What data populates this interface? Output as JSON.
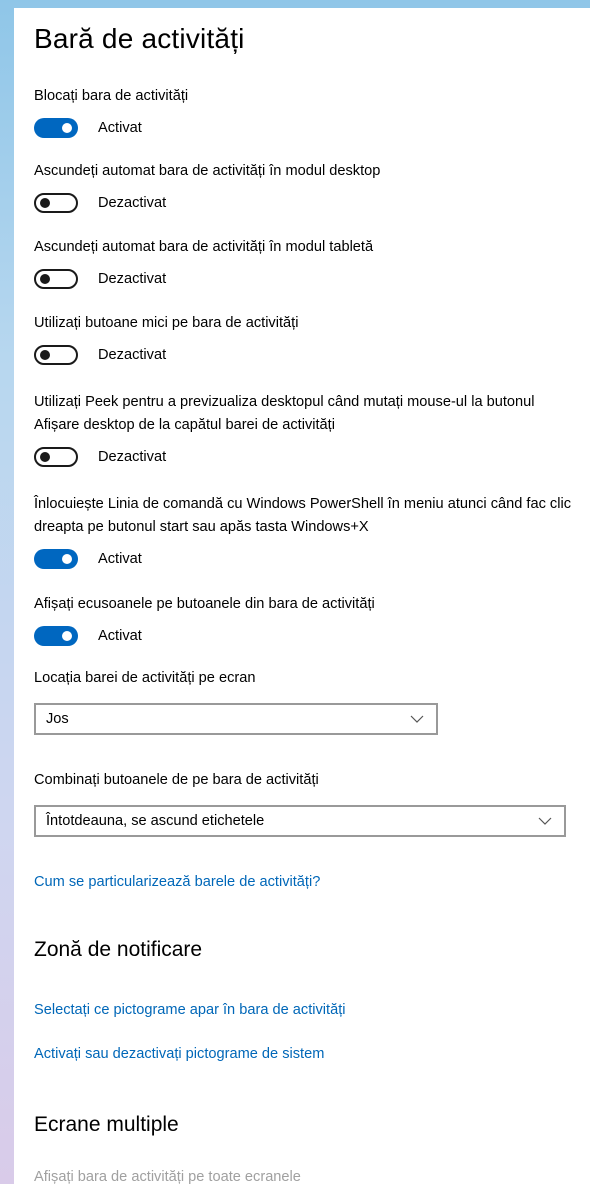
{
  "title": "Bară de activități",
  "settings": [
    {
      "label": "Blocați bara de activități",
      "state": "Activat",
      "on": true
    },
    {
      "label": "Ascundeți automat bara de activități în modul desktop",
      "state": "Dezactivat",
      "on": false
    },
    {
      "label": "Ascundeți automat bara de activități în modul tabletă",
      "state": "Dezactivat",
      "on": false
    },
    {
      "label": "Utilizați butoane mici pe bara de activități",
      "state": "Dezactivat",
      "on": false
    },
    {
      "label": "Utilizați Peek pentru a previzualiza desktopul când mutați mouse-ul la butonul Afișare desktop de la capătul barei de activități",
      "state": "Dezactivat",
      "on": false
    },
    {
      "label": "Înlocuiește Linia de comandă cu Windows PowerShell în meniu atunci când fac clic dreapta pe butonul start sau apăs tasta Windows+X",
      "state": "Activat",
      "on": true
    },
    {
      "label": "Afișați ecusoanele pe butoanele din bara de activități",
      "state": "Activat",
      "on": true
    }
  ],
  "location": {
    "label": "Locația barei de activități pe ecran",
    "value": "Jos"
  },
  "combine": {
    "label": "Combinați butoanele de pe bara de activități",
    "value": "Întotdeauna, se ascund etichetele"
  },
  "help_link": "Cum se particularizează barele de activități?",
  "notification_area": {
    "title": "Zonă de notificare",
    "link_icons": "Selectați ce pictograme apar în bara de activități",
    "link_system": "Activați sau dezactivați pictograme de sistem"
  },
  "multiple_displays": {
    "title": "Ecrane multiple",
    "show_on_all": "Afișați bara de activități pe toate ecranele"
  },
  "colors": {
    "accent": "#0067c0",
    "link": "#0067b8"
  }
}
